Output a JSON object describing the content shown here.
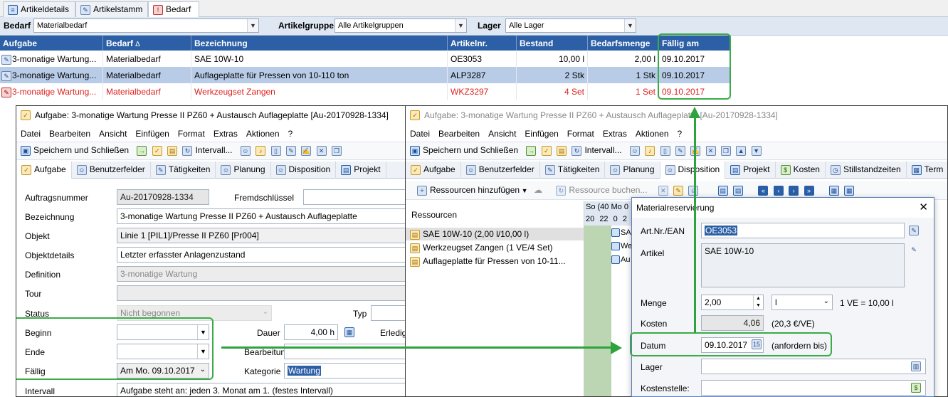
{
  "top_tabs": [
    {
      "label": "Artikeldetails",
      "icon": "details-icon"
    },
    {
      "label": "Artikelstamm",
      "icon": "tools-icon"
    },
    {
      "label": "Bedarf",
      "icon": "alert-icon"
    }
  ],
  "filter": {
    "bedarf_label": "Bedarf",
    "bedarf_value": "Materialbedarf",
    "artikelgruppe_label": "Artikelgruppe",
    "artikelgruppe_value": "Alle Artikelgruppen",
    "lager_label": "Lager",
    "lager_value": "Alle Lager"
  },
  "grid": {
    "columns": [
      "Aufgabe",
      "Bedarf",
      "Bezeichnung",
      "Artikelnr.",
      "Bestand",
      "Bedarfsmenge",
      "Fällig am"
    ],
    "rows": [
      {
        "aufgabe": "3-monatige Wartung...",
        "bedarf": "Materialbedarf",
        "bezeichnung": "SAE 10W-10",
        "artikelnr": "OE3053",
        "bestand": "10,00 l",
        "menge": "2,00 l",
        "faellig": "09.10.2017"
      },
      {
        "aufgabe": "3-monatige Wartung...",
        "bedarf": "Materialbedarf",
        "bezeichnung": "Auflageplatte für Pressen von 10-110 ton",
        "artikelnr": "ALP3287",
        "bestand": "2 Stk",
        "menge": "1 Stk",
        "faellig": "09.10.2017"
      },
      {
        "aufgabe": "3-monatige Wartung...",
        "bedarf": "Materialbedarf",
        "bezeichnung": "Werkzeugset Zangen",
        "artikelnr": "WKZ3297",
        "bestand": "4 Set",
        "menge": "1 Set",
        "faellig": "09.10.2017"
      }
    ],
    "sort_indicator": "∆"
  },
  "left_window": {
    "title": "Aufgabe: 3-monatige Wartung Presse II PZ60 + Austausch Auflageplatte [Au-20170928-1334]",
    "menu": [
      "Datei",
      "Bearbeiten",
      "Ansicht",
      "Einfügen",
      "Format",
      "Extras",
      "Aktionen",
      "?"
    ],
    "toolbar": {
      "save": "Speichern und Schließen",
      "interval": "Intervall..."
    },
    "tabs": [
      "Aufgabe",
      "Benutzerfelder",
      "Tätigkeiten",
      "Planung",
      "Disposition",
      "Projekt"
    ],
    "fields": {
      "auftragsnummer_label": "Auftragsnummer",
      "auftragsnummer": "Au-20170928-1334",
      "fremd_label": "Fremdschlüssel",
      "bezeichnung_label": "Bezeichnung",
      "bezeichnung": "3-monatige Wartung Presse II PZ60 + Austausch Auflageplatte",
      "objekt_label": "Objekt",
      "objekt": "Linie 1 [PIL1]/Presse II PZ60 [Pr004]",
      "objektdetails_label": "Objektdetails",
      "objektdetails": "Letzter erfasster Anlagenzustand",
      "definition_label": "Definition",
      "definition": "3-monatige Wartung",
      "tour_label": "Tour",
      "status_label": "Status",
      "status": "Nicht begonnen",
      "typ_label": "Typ",
      "beginn_label": "Beginn",
      "dauer_label": "Dauer",
      "dauer": "4,00 h",
      "erledigt_label": "Erledig",
      "ende_label": "Ende",
      "bearbeitung_label": "Bearbeitung",
      "faellig_label": "Fällig",
      "faellig": "Am Mo. 09.10.2017",
      "kategorie_label": "Kategorie",
      "kategorie": "Wartung",
      "intervall_label": "Intervall",
      "intervall": "Aufgabe steht an: jeden 3. Monat am 1.  (festes Intervall)"
    }
  },
  "right_window": {
    "title": "Aufgabe: 3-monatige Wartung Presse II PZ60 + Austausch Auflageplatte [Au-20170928-1334]",
    "menu": [
      "Datei",
      "Bearbeiten",
      "Ansicht",
      "Einfügen",
      "Format",
      "Extras",
      "Aktionen",
      "?"
    ],
    "toolbar": {
      "save": "Speichern und Schließen",
      "interval": "Intervall..."
    },
    "tabs": [
      "Aufgabe",
      "Benutzerfelder",
      "Tätigkeiten",
      "Planung",
      "Disposition",
      "Projekt",
      "Kosten",
      "Stillstandzeiten",
      "Term"
    ],
    "res_toolbar": {
      "add": "Ressourcen hinzufügen",
      "book": "Ressource buchen..."
    },
    "res_header": "Ressourcen",
    "resources": [
      "SAE 10W-10 (2,00 l/10,00 l)",
      "Werkzeugset Zangen (1 VE/4 Set)",
      "Auflageplatte für Pressen von 10-11..."
    ],
    "cal_header1": [
      "So (40",
      "Mo 0"
    ],
    "cal_header2": [
      "20",
      "22",
      "0",
      "2"
    ],
    "cal_items": [
      "SA",
      "We",
      "Au"
    ]
  },
  "dialog": {
    "title": "Materialreservierung",
    "close": "✕",
    "artnr_label": "Art.Nr./EAN",
    "artnr": "OE3053",
    "artikel_label": "Artikel",
    "artikel": "SAE 10W-10",
    "menge_label": "Menge",
    "menge": "2,00",
    "unit": "l",
    "ve": "1 VE = 10,00 l",
    "kosten_label": "Kosten",
    "kosten": "4,06",
    "kosten_note": "(20,3 €/VE)",
    "datum_label": "Datum",
    "datum": "09.10.2017",
    "datum_note": "(anfordern bis)",
    "lager_label": "Lager",
    "kostenstelle_label": "Kostenstelle:"
  },
  "colors": {
    "header_blue": "#2c5fa6",
    "selected_row": "#b8cce8",
    "red_text": "#e02020",
    "highlight_green": "#3aab46"
  }
}
